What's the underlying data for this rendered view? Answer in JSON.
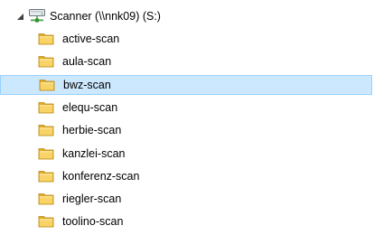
{
  "drive": {
    "label": "Scanner (\\\\nnk09) (S:)",
    "icon": "network-drive-icon",
    "expanded": true
  },
  "folders": [
    {
      "label": "active-scan",
      "selected": false
    },
    {
      "label": "aula-scan",
      "selected": false
    },
    {
      "label": "bwz-scan",
      "selected": true
    },
    {
      "label": "elequ-scan",
      "selected": false
    },
    {
      "label": "herbie-scan",
      "selected": false
    },
    {
      "label": "kanzlei-scan",
      "selected": false
    },
    {
      "label": "konferenz-scan",
      "selected": false
    },
    {
      "label": "riegler-scan",
      "selected": false
    },
    {
      "label": "toolino-scan",
      "selected": false
    }
  ],
  "colors": {
    "selection_background": "#cce8ff",
    "selection_border": "#99d1ff",
    "folder_yellow": "#f5c84c"
  }
}
